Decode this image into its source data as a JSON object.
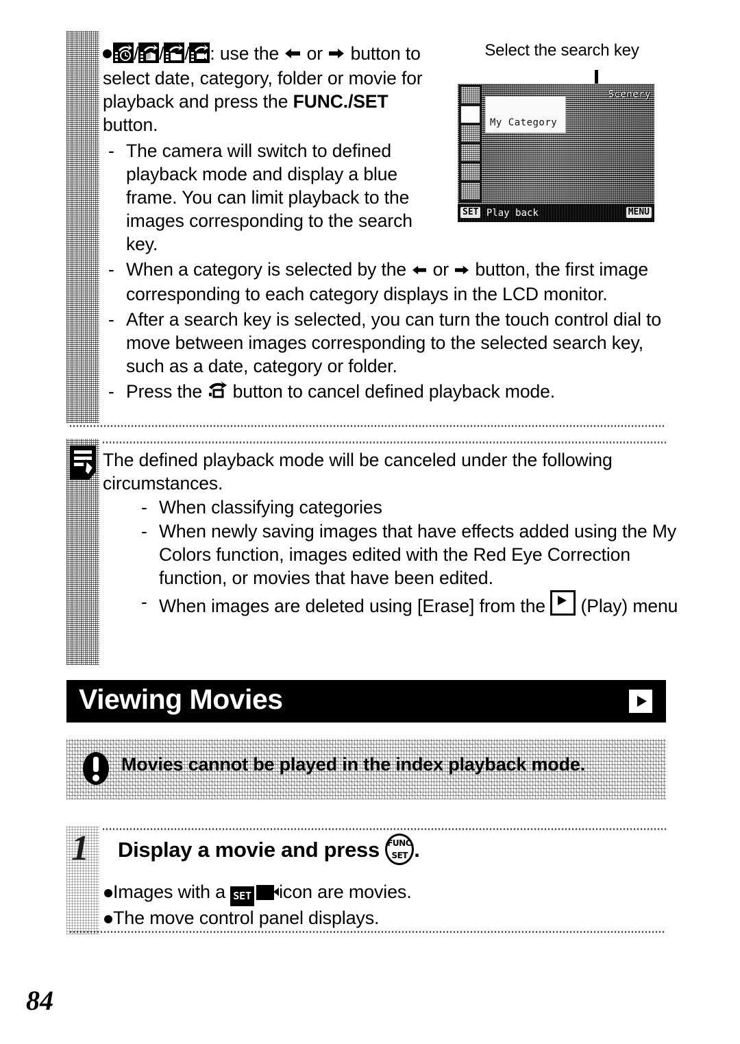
{
  "page": {
    "number": "84"
  },
  "section_jump": {
    "bullet": {
      "icons": [
        "jump-date-icon",
        "jump-category-icon",
        "jump-folder-icon",
        "jump-movie-icon"
      ],
      "text_before_arrows": ": use the",
      "or": "or",
      "text_after_arrows": "button to select date, category, folder or movie for playback and press the",
      "bold_term": "FUNC./SET",
      "text_end": "button."
    },
    "dashes": [
      "The camera will switch to defined playback mode and display a blue frame. You can limit playback to the images corresponding to the search key.",
      "When a category is selected by the ← or → button, the first image corresponding to each category displays in the LCD monitor.",
      "After a search key is selected, you can turn the touch control dial to move between images corresponding to the selected search key, such as a date, category or folder.",
      "Press the [jump] button to cancel defined playback mode."
    ],
    "dash_2_part1": "When a category is selected by the",
    "dash_2_part2": "button, the first image corresponding to each category displays in the LCD monitor.",
    "dash_3": "After a search key is selected, you can turn the touch control dial to move between images corresponding to the selected search key, such as a date, category or folder.",
    "dash_4_part1": "Press the",
    "dash_4_part2": "button to cancel defined playback mode."
  },
  "figure": {
    "caption": "Select the search key",
    "lcd": {
      "popup_label": "My Category",
      "scenery_label": "Scenery",
      "bottom_left_key": "SET",
      "bottom_left_label": "Play back",
      "bottom_right_key": "MENU",
      "sidebar_icons": [
        "category-all-icon",
        "category-people-icon",
        "category-scenery-icon",
        "category-events-icon",
        "category-cat1-icon",
        "category-task-icon"
      ],
      "selected_sidebar_index": 1
    }
  },
  "note": {
    "icon": "note-pencil-icon",
    "intro": "The defined playback mode will be canceled under the following circumstances.",
    "items": [
      "When classifying categories",
      "When newly saving images that have effects added using the My Colors function, images edited with the Red Eye Correction function, or movies that have been edited.",
      "When images are deleted using [Erase] from the"
    ],
    "item3_icon": "play-mode-icon",
    "item3_tail": "(Play) menu"
  },
  "banner": {
    "title": "Viewing Movies",
    "icon": "play-mode-icon"
  },
  "caution": {
    "icon": "exclamation-icon",
    "text": "Movies cannot be played in the index playback mode."
  },
  "step1": {
    "number": "1",
    "heading_before": "Display a movie and press",
    "button_icon_top": "FUNC.",
    "button_icon_bottom": "SET",
    "heading_after": ".",
    "bullets": [
      {
        "before": "Images with a",
        "icon_set": "SET",
        "icon_name": "movie-icon",
        "after": "icon are movies."
      },
      {
        "before": "The move control panel displays.",
        "icon_set": "",
        "icon_name": "",
        "after": ""
      }
    ]
  },
  "symbols": {
    "left_arrow": "◀",
    "right_arrow": "▶",
    "dash": "-",
    "slash": "/"
  },
  "colors": {
    "ink": "#000000",
    "paper": "#ffffff",
    "banner_bg": "#000000",
    "banner_fg": "#ffffff"
  }
}
